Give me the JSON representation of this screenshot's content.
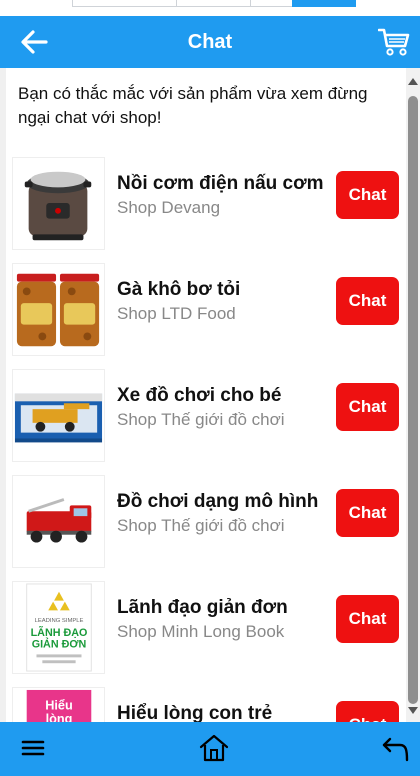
{
  "header": {
    "title": "Chat"
  },
  "intro": "Bạn có thắc mắc với sản phẩm vừa xem đừng ngại chat với shop!",
  "items": [
    {
      "name": "Nồi cơm điện nấu cơm",
      "shop": "Shop Devang",
      "chat_label": "Chat"
    },
    {
      "name": "Gà khô bơ tỏi",
      "shop": "Shop LTD Food",
      "chat_label": "Chat"
    },
    {
      "name": "Xe đồ chơi cho bé",
      "shop": "Shop Thế giới đồ chơi",
      "chat_label": "Chat"
    },
    {
      "name": "Đồ chơi dạng mô hình",
      "shop": "Shop Thế giới đồ chơi",
      "chat_label": "Chat"
    },
    {
      "name": "Lãnh đạo giản đơn",
      "shop": "Shop Minh Long Book",
      "chat_label": "Chat"
    },
    {
      "name": "Hiểu lòng con trẻ",
      "shop": "",
      "chat_label": "Chat"
    }
  ],
  "book1": {
    "top": "LEADING SIMPLE",
    "title_line1": "LÃNH ĐẠO",
    "title_line2": "GIẢN ĐƠN"
  },
  "book2": {
    "title_line1": "Hiểu",
    "title_line2": "lòng"
  },
  "colors": {
    "header": "#1f9bf0",
    "chat_button": "#ee1111",
    "footer": "#1f9bf0"
  },
  "icons": {
    "back": "arrow-left-icon",
    "cart": "cart-icon",
    "menu": "menu-icon",
    "home": "home-icon",
    "reply": "reply-icon"
  }
}
